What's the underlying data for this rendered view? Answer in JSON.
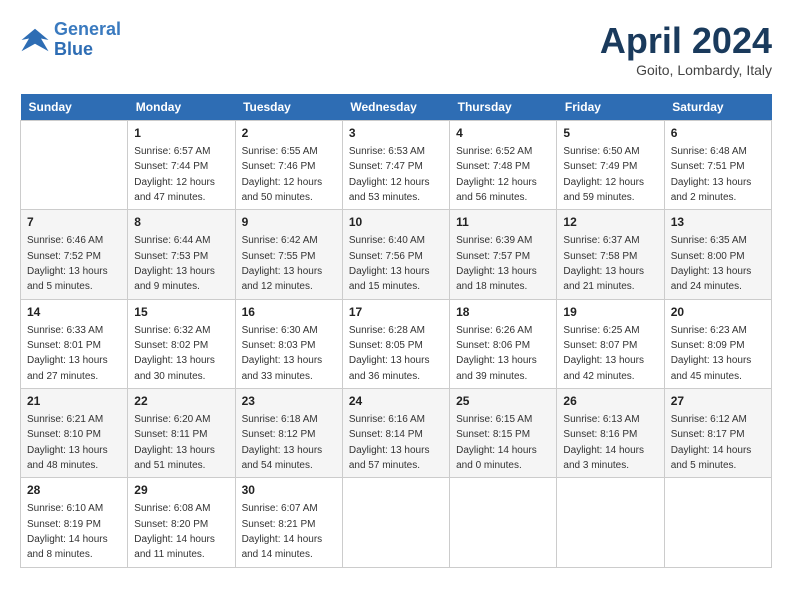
{
  "header": {
    "logo_line1": "General",
    "logo_line2": "Blue",
    "month_title": "April 2024",
    "location": "Goito, Lombardy, Italy"
  },
  "calendar": {
    "days_of_week": [
      "Sunday",
      "Monday",
      "Tuesday",
      "Wednesday",
      "Thursday",
      "Friday",
      "Saturday"
    ],
    "weeks": [
      [
        {
          "day": "",
          "sunrise": "",
          "sunset": "",
          "daylight": ""
        },
        {
          "day": "1",
          "sunrise": "Sunrise: 6:57 AM",
          "sunset": "Sunset: 7:44 PM",
          "daylight": "Daylight: 12 hours and 47 minutes."
        },
        {
          "day": "2",
          "sunrise": "Sunrise: 6:55 AM",
          "sunset": "Sunset: 7:46 PM",
          "daylight": "Daylight: 12 hours and 50 minutes."
        },
        {
          "day": "3",
          "sunrise": "Sunrise: 6:53 AM",
          "sunset": "Sunset: 7:47 PM",
          "daylight": "Daylight: 12 hours and 53 minutes."
        },
        {
          "day": "4",
          "sunrise": "Sunrise: 6:52 AM",
          "sunset": "Sunset: 7:48 PM",
          "daylight": "Daylight: 12 hours and 56 minutes."
        },
        {
          "day": "5",
          "sunrise": "Sunrise: 6:50 AM",
          "sunset": "Sunset: 7:49 PM",
          "daylight": "Daylight: 12 hours and 59 minutes."
        },
        {
          "day": "6",
          "sunrise": "Sunrise: 6:48 AM",
          "sunset": "Sunset: 7:51 PM",
          "daylight": "Daylight: 13 hours and 2 minutes."
        }
      ],
      [
        {
          "day": "7",
          "sunrise": "Sunrise: 6:46 AM",
          "sunset": "Sunset: 7:52 PM",
          "daylight": "Daylight: 13 hours and 5 minutes."
        },
        {
          "day": "8",
          "sunrise": "Sunrise: 6:44 AM",
          "sunset": "Sunset: 7:53 PM",
          "daylight": "Daylight: 13 hours and 9 minutes."
        },
        {
          "day": "9",
          "sunrise": "Sunrise: 6:42 AM",
          "sunset": "Sunset: 7:55 PM",
          "daylight": "Daylight: 13 hours and 12 minutes."
        },
        {
          "day": "10",
          "sunrise": "Sunrise: 6:40 AM",
          "sunset": "Sunset: 7:56 PM",
          "daylight": "Daylight: 13 hours and 15 minutes."
        },
        {
          "day": "11",
          "sunrise": "Sunrise: 6:39 AM",
          "sunset": "Sunset: 7:57 PM",
          "daylight": "Daylight: 13 hours and 18 minutes."
        },
        {
          "day": "12",
          "sunrise": "Sunrise: 6:37 AM",
          "sunset": "Sunset: 7:58 PM",
          "daylight": "Daylight: 13 hours and 21 minutes."
        },
        {
          "day": "13",
          "sunrise": "Sunrise: 6:35 AM",
          "sunset": "Sunset: 8:00 PM",
          "daylight": "Daylight: 13 hours and 24 minutes."
        }
      ],
      [
        {
          "day": "14",
          "sunrise": "Sunrise: 6:33 AM",
          "sunset": "Sunset: 8:01 PM",
          "daylight": "Daylight: 13 hours and 27 minutes."
        },
        {
          "day": "15",
          "sunrise": "Sunrise: 6:32 AM",
          "sunset": "Sunset: 8:02 PM",
          "daylight": "Daylight: 13 hours and 30 minutes."
        },
        {
          "day": "16",
          "sunrise": "Sunrise: 6:30 AM",
          "sunset": "Sunset: 8:03 PM",
          "daylight": "Daylight: 13 hours and 33 minutes."
        },
        {
          "day": "17",
          "sunrise": "Sunrise: 6:28 AM",
          "sunset": "Sunset: 8:05 PM",
          "daylight": "Daylight: 13 hours and 36 minutes."
        },
        {
          "day": "18",
          "sunrise": "Sunrise: 6:26 AM",
          "sunset": "Sunset: 8:06 PM",
          "daylight": "Daylight: 13 hours and 39 minutes."
        },
        {
          "day": "19",
          "sunrise": "Sunrise: 6:25 AM",
          "sunset": "Sunset: 8:07 PM",
          "daylight": "Daylight: 13 hours and 42 minutes."
        },
        {
          "day": "20",
          "sunrise": "Sunrise: 6:23 AM",
          "sunset": "Sunset: 8:09 PM",
          "daylight": "Daylight: 13 hours and 45 minutes."
        }
      ],
      [
        {
          "day": "21",
          "sunrise": "Sunrise: 6:21 AM",
          "sunset": "Sunset: 8:10 PM",
          "daylight": "Daylight: 13 hours and 48 minutes."
        },
        {
          "day": "22",
          "sunrise": "Sunrise: 6:20 AM",
          "sunset": "Sunset: 8:11 PM",
          "daylight": "Daylight: 13 hours and 51 minutes."
        },
        {
          "day": "23",
          "sunrise": "Sunrise: 6:18 AM",
          "sunset": "Sunset: 8:12 PM",
          "daylight": "Daylight: 13 hours and 54 minutes."
        },
        {
          "day": "24",
          "sunrise": "Sunrise: 6:16 AM",
          "sunset": "Sunset: 8:14 PM",
          "daylight": "Daylight: 13 hours and 57 minutes."
        },
        {
          "day": "25",
          "sunrise": "Sunrise: 6:15 AM",
          "sunset": "Sunset: 8:15 PM",
          "daylight": "Daylight: 14 hours and 0 minutes."
        },
        {
          "day": "26",
          "sunrise": "Sunrise: 6:13 AM",
          "sunset": "Sunset: 8:16 PM",
          "daylight": "Daylight: 14 hours and 3 minutes."
        },
        {
          "day": "27",
          "sunrise": "Sunrise: 6:12 AM",
          "sunset": "Sunset: 8:17 PM",
          "daylight": "Daylight: 14 hours and 5 minutes."
        }
      ],
      [
        {
          "day": "28",
          "sunrise": "Sunrise: 6:10 AM",
          "sunset": "Sunset: 8:19 PM",
          "daylight": "Daylight: 14 hours and 8 minutes."
        },
        {
          "day": "29",
          "sunrise": "Sunrise: 6:08 AM",
          "sunset": "Sunset: 8:20 PM",
          "daylight": "Daylight: 14 hours and 11 minutes."
        },
        {
          "day": "30",
          "sunrise": "Sunrise: 6:07 AM",
          "sunset": "Sunset: 8:21 PM",
          "daylight": "Daylight: 14 hours and 14 minutes."
        },
        {
          "day": "",
          "sunrise": "",
          "sunset": "",
          "daylight": ""
        },
        {
          "day": "",
          "sunrise": "",
          "sunset": "",
          "daylight": ""
        },
        {
          "day": "",
          "sunrise": "",
          "sunset": "",
          "daylight": ""
        },
        {
          "day": "",
          "sunrise": "",
          "sunset": "",
          "daylight": ""
        }
      ]
    ]
  }
}
